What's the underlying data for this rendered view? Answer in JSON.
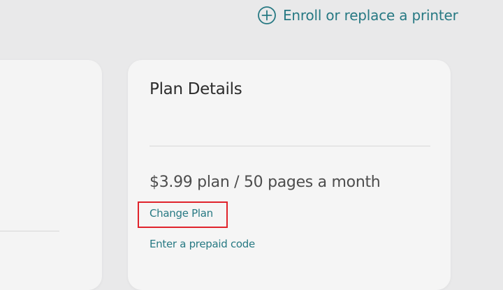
{
  "header": {
    "enroll_label": "Enroll or replace a printer",
    "enroll_icon": "plus-circle-icon"
  },
  "plan_card": {
    "title": "Plan Details",
    "price_text": "$3.99 plan / 50 pages a month",
    "change_plan_label": "Change Plan",
    "prepaid_label": "Enter a prepaid code"
  },
  "colors": {
    "accent": "#277983",
    "highlight": "#e0232b",
    "card_background": "#f5f5f5",
    "page_background": "#e9e9ea"
  }
}
